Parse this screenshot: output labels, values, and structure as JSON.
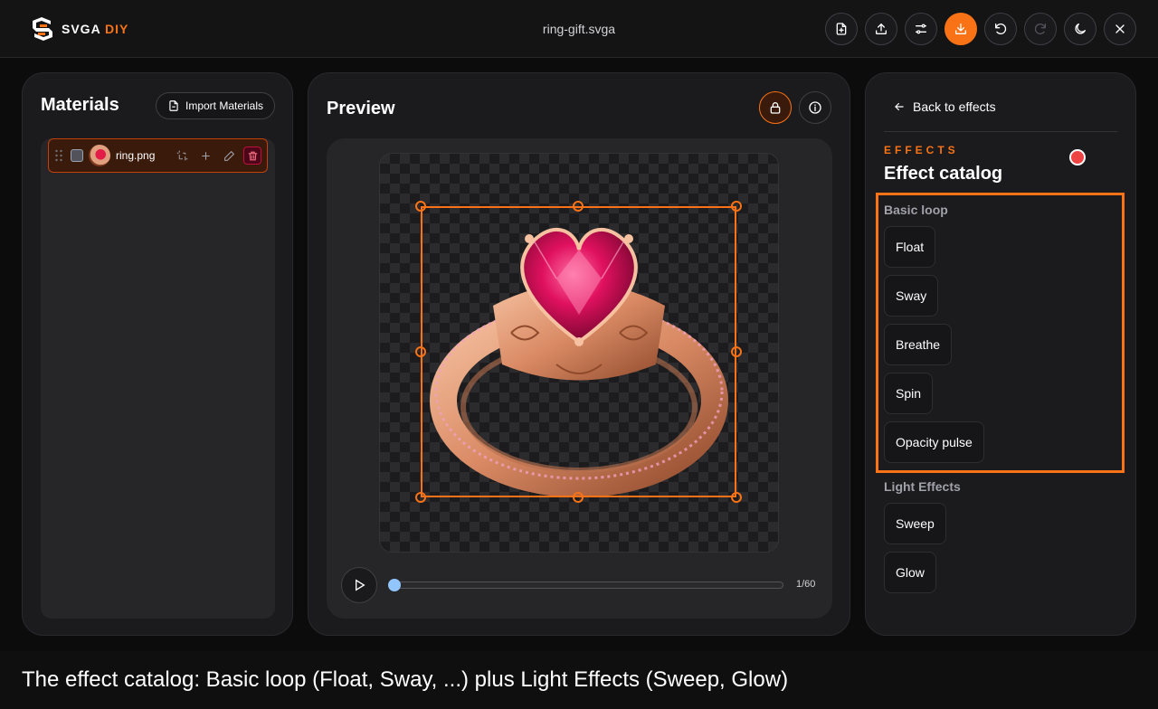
{
  "header": {
    "logo_text": "SVGA",
    "logo_accent": "DIY",
    "file_name": "ring-gift.svga",
    "accent_color": "#f97316",
    "toolbar": [
      {
        "name": "new-file-button",
        "icon": "file-plus-icon",
        "state": "normal"
      },
      {
        "name": "upload-button",
        "icon": "upload-icon",
        "state": "normal"
      },
      {
        "name": "settings-button",
        "icon": "sliders-icon",
        "state": "normal"
      },
      {
        "name": "download-button",
        "icon": "download-icon",
        "state": "primary"
      },
      {
        "name": "undo-button",
        "icon": "undo-icon",
        "state": "normal"
      },
      {
        "name": "redo-button",
        "icon": "redo-icon",
        "state": "disabled"
      },
      {
        "name": "theme-toggle-button",
        "icon": "moon-icon",
        "state": "normal"
      },
      {
        "name": "close-button",
        "icon": "close-icon",
        "state": "normal"
      }
    ]
  },
  "materials": {
    "title": "Materials",
    "import_label": "Import Materials",
    "items": [
      {
        "name": "ring.png",
        "selected": true,
        "checked": false
      }
    ]
  },
  "preview": {
    "title": "Preview",
    "lock_active": true,
    "frame_counter": "1/60",
    "progress": 0.0
  },
  "effects": {
    "back_label": "Back to effects",
    "eyebrow": "EFFECTS",
    "title": "Effect catalog",
    "groups": [
      {
        "label": "Basic loop",
        "items": [
          "Float",
          "Sway",
          "Breathe",
          "Spin",
          "Opacity pulse"
        ]
      },
      {
        "label": "Light Effects",
        "items": [
          "Sweep",
          "Glow"
        ]
      }
    ]
  },
  "caption": "The effect catalog: Basic loop (Float, Sway, ...) plus Light Effects (Sweep, Glow)"
}
